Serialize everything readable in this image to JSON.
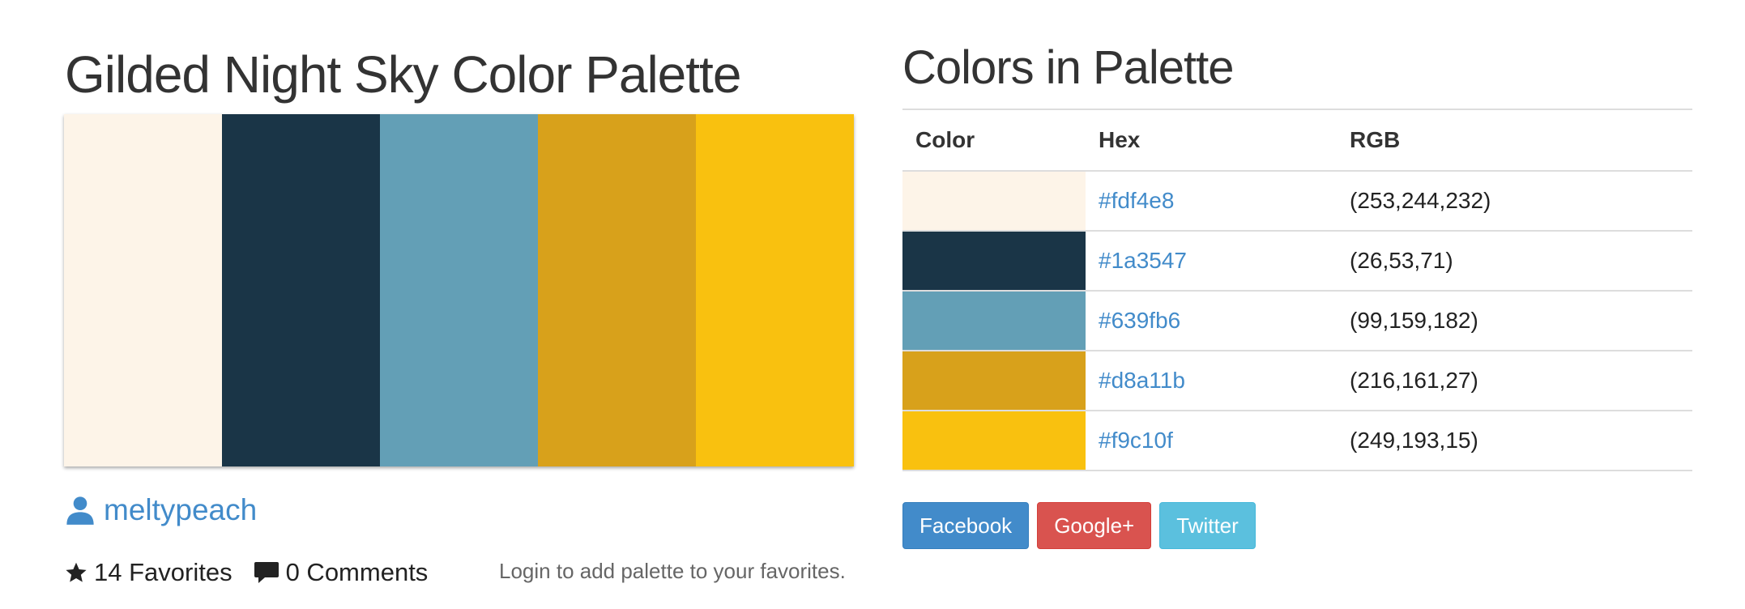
{
  "palette": {
    "title": "Gilded Night Sky Color Palette",
    "colors": [
      "#fdf4e8",
      "#1a3547",
      "#639fb6",
      "#d8a11b",
      "#f9c10f"
    ]
  },
  "author": {
    "icon": "user-icon",
    "name": "meltypeach"
  },
  "stats": {
    "favorites_icon": "star-icon",
    "favorites": "14 Favorites",
    "comments_icon": "comment-icon",
    "comments": "0 Comments",
    "login_note": "Login to add palette to your favorites."
  },
  "colors_section": {
    "title": "Colors in Palette",
    "headers": {
      "color": "Color",
      "hex": "Hex",
      "rgb": "RGB"
    },
    "rows": [
      {
        "swatch": "#fdf4e8",
        "hex": "#fdf4e8",
        "rgb": "(253,244,232)"
      },
      {
        "swatch": "#1a3547",
        "hex": "#1a3547",
        "rgb": "(26,53,71)"
      },
      {
        "swatch": "#639fb6",
        "hex": "#639fb6",
        "rgb": "(99,159,182)"
      },
      {
        "swatch": "#d8a11b",
        "hex": "#d8a11b",
        "rgb": "(216,161,27)"
      },
      {
        "swatch": "#f9c10f",
        "hex": "#f9c10f",
        "rgb": "(249,193,15)"
      }
    ]
  },
  "share": {
    "facebook": "Facebook",
    "google": "Google+",
    "twitter": "Twitter"
  },
  "theme": {
    "link": "#428bca",
    "facebook": "#428bca",
    "google": "#d9534f",
    "twitter": "#5bc0de"
  }
}
